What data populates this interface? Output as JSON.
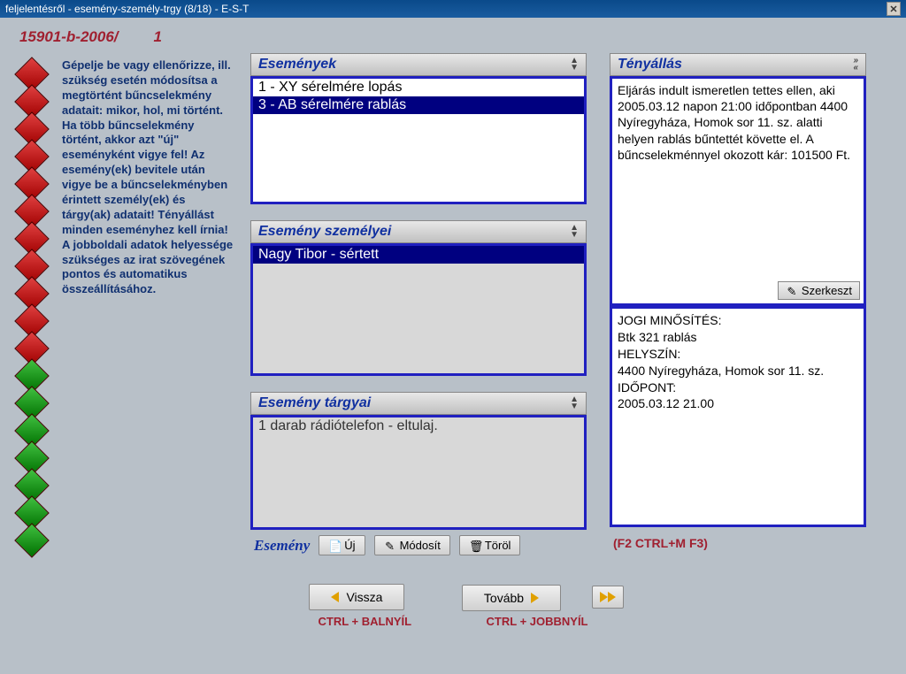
{
  "window": {
    "title": "feljelentésről - esemény-személy-trgy (8/18) - E-S-T"
  },
  "case": {
    "no": "15901-b-2006/",
    "seq": "1"
  },
  "help": {
    "text": "Gépelje be vagy ellenőrizze, ill. szükség esetén módosítsa a megtörtént bűncselekmény adatait: mikor, hol, mi történt. Ha több bűncselekmény történt, akkor azt \"új\" eseményként vigye fel! Az esemény(ek) bevitele után vigye be a bűncselekményben érintett személy(ek) és tárgy(ak) adatait! Tényállást minden eseményhez kell írnia! A jobboldali adatok helyessége szükséges az irat szövegének pontos és automatikus összeállításához."
  },
  "panels": {
    "events": {
      "title": "Események",
      "items": [
        "1 - XY sérelmére lopás",
        "3 - AB sérelmére rablás"
      ],
      "selected": 1
    },
    "persons": {
      "title": "Esemény személyei",
      "items": [
        "Nagy Tibor - sértett"
      ],
      "selected": 0
    },
    "objects": {
      "title": "Esemény tárgyai",
      "items": [
        "1 darab rádiótelefon - eltulaj."
      ]
    }
  },
  "facts": {
    "title": "Tényállás",
    "text": "Eljárás indult ismeretlen tettes ellen, aki 2005.03.12 napon 21:00 időpontban 4400 Nyíregyháza, Homok sor 11. sz. alatti helyen rablás bűntettét követte el. A bűncselekménnyel okozott kár: 101500 Ft.",
    "edit": "Szerkeszt"
  },
  "legal": {
    "l1": "JOGI MINŐSÍTÉS:",
    "l2": "Btk 321 rablás",
    "l3": "HELYSZÍN:",
    "l4": "4400 Nyíregyháza, Homok sor 11. sz.",
    "l5": "IDŐPONT:",
    "l6": "2005.03.12 21.00"
  },
  "actions": {
    "label": "Esemény",
    "new": "Új",
    "modify": "Módosít",
    "delete": "Töröl",
    "shortcuts": "(F2  CTRL+M  F3)"
  },
  "nav": {
    "back": "Vissza",
    "next": "Tovább",
    "hint_back": "CTRL + BALNYÍL",
    "hint_next": "CTRL + JOBBNYÍL"
  }
}
